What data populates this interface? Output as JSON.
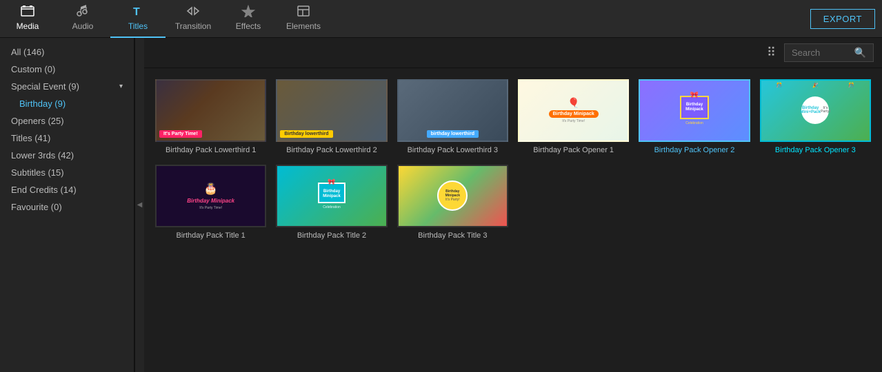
{
  "toolbar": {
    "export_label": "EXPORT",
    "items": [
      {
        "id": "media",
        "label": "Media",
        "icon": "🗂"
      },
      {
        "id": "audio",
        "label": "Audio",
        "icon": "♪"
      },
      {
        "id": "titles",
        "label": "Titles",
        "icon": "T"
      },
      {
        "id": "transition",
        "label": "Transition",
        "icon": "⇄"
      },
      {
        "id": "effects",
        "label": "Effects",
        "icon": "✦"
      },
      {
        "id": "elements",
        "label": "Elements",
        "icon": "🖼"
      }
    ],
    "active_item": "titles"
  },
  "sidebar": {
    "items": [
      {
        "id": "all",
        "label": "All (146)",
        "active": false
      },
      {
        "id": "custom",
        "label": "Custom (0)",
        "active": false
      },
      {
        "id": "special-event",
        "label": "Special Event (9)",
        "group": true,
        "expanded": true
      },
      {
        "id": "birthday",
        "label": "Birthday (9)",
        "active": true,
        "indent": true
      },
      {
        "id": "openers",
        "label": "Openers (25)",
        "active": false
      },
      {
        "id": "titles",
        "label": "Titles (41)",
        "active": false
      },
      {
        "id": "lower3rds",
        "label": "Lower 3rds (42)",
        "active": false
      },
      {
        "id": "subtitles",
        "label": "Subtitles (15)",
        "active": false
      },
      {
        "id": "endcredits",
        "label": "End Credits (14)",
        "active": false
      },
      {
        "id": "favourite",
        "label": "Favourite (0)",
        "active": false
      }
    ]
  },
  "content": {
    "search_placeholder": "Search",
    "grid_items": [
      {
        "id": "lt1",
        "label": "Birthday Pack Lowerthird 1",
        "type": "lt1",
        "selected": false
      },
      {
        "id": "lt2",
        "label": "Birthday Pack Lowerthird 2",
        "type": "lt2",
        "selected": false
      },
      {
        "id": "lt3",
        "label": "Birthday Pack Lowerthird 3",
        "type": "lt3",
        "selected": false
      },
      {
        "id": "op1",
        "label": "Birthday Pack Opener 1",
        "type": "op1",
        "selected": false
      },
      {
        "id": "op2",
        "label": "Birthday Pack Opener 2",
        "type": "op2",
        "selected": true
      },
      {
        "id": "op3",
        "label": "Birthday Pack Opener 3",
        "type": "op3",
        "selected": true,
        "active_label": true
      },
      {
        "id": "t1",
        "label": "Birthday Pack Title 1",
        "type": "t1",
        "selected": false
      },
      {
        "id": "t2",
        "label": "Birthday Pack Title 2",
        "type": "t2",
        "selected": false
      },
      {
        "id": "t3",
        "label": "Birthday Pack Title 3",
        "type": "t3",
        "selected": false
      }
    ]
  }
}
